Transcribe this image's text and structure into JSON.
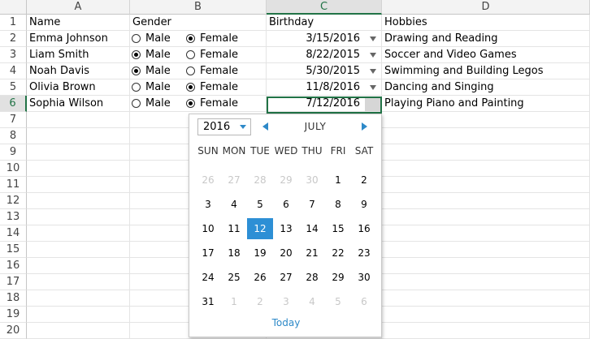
{
  "columns": [
    "A",
    "B",
    "C",
    "D"
  ],
  "rows": [
    "1",
    "2",
    "3",
    "4",
    "5",
    "6",
    "7",
    "8",
    "9",
    "10",
    "11",
    "12",
    "13",
    "14",
    "15",
    "16",
    "17",
    "18",
    "19",
    "20"
  ],
  "headers": {
    "name": "Name",
    "gender": "Gender",
    "birthday": "Birthday",
    "hobbies": "Hobbies"
  },
  "gender_options": {
    "male": "Male",
    "female": "Female"
  },
  "records": [
    {
      "name": "Emma Johnson",
      "gender": "Female",
      "birthday": "3/15/2016",
      "hobbies": "Drawing and Reading"
    },
    {
      "name": "Liam Smith",
      "gender": "Male",
      "birthday": "8/22/2015",
      "hobbies": "Soccer and Video Games"
    },
    {
      "name": "Noah Davis",
      "gender": "Male",
      "birthday": "5/30/2015",
      "hobbies": "Swimming and Building Legos"
    },
    {
      "name": "Olivia Brown",
      "gender": "Female",
      "birthday": "11/8/2016",
      "hobbies": "Dancing and Singing"
    },
    {
      "name": "Sophia Wilson",
      "gender": "Female",
      "birthday": "7/12/2016",
      "hobbies": "Playing Piano and Painting"
    }
  ],
  "calendar": {
    "year": "2016",
    "month": "JULY",
    "weekdays": [
      "SUN",
      "MON",
      "TUE",
      "WED",
      "THU",
      "FRI",
      "SAT"
    ],
    "weeks": [
      [
        {
          "d": "26",
          "o": true
        },
        {
          "d": "27",
          "o": true
        },
        {
          "d": "28",
          "o": true
        },
        {
          "d": "29",
          "o": true
        },
        {
          "d": "30",
          "o": true
        },
        {
          "d": "1"
        },
        {
          "d": "2"
        }
      ],
      [
        {
          "d": "3"
        },
        {
          "d": "4"
        },
        {
          "d": "5"
        },
        {
          "d": "6"
        },
        {
          "d": "7"
        },
        {
          "d": "8"
        },
        {
          "d": "9"
        }
      ],
      [
        {
          "d": "10"
        },
        {
          "d": "11"
        },
        {
          "d": "12",
          "s": true
        },
        {
          "d": "13"
        },
        {
          "d": "14"
        },
        {
          "d": "15"
        },
        {
          "d": "16"
        }
      ],
      [
        {
          "d": "17"
        },
        {
          "d": "18"
        },
        {
          "d": "19"
        },
        {
          "d": "20"
        },
        {
          "d": "21"
        },
        {
          "d": "22"
        },
        {
          "d": "23"
        }
      ],
      [
        {
          "d": "24"
        },
        {
          "d": "25"
        },
        {
          "d": "26"
        },
        {
          "d": "27"
        },
        {
          "d": "28"
        },
        {
          "d": "29"
        },
        {
          "d": "30"
        }
      ],
      [
        {
          "d": "31"
        },
        {
          "d": "1",
          "o": true
        },
        {
          "d": "2",
          "o": true
        },
        {
          "d": "3",
          "o": true
        },
        {
          "d": "4",
          "o": true
        },
        {
          "d": "5",
          "o": true
        },
        {
          "d": "6",
          "o": true
        }
      ]
    ],
    "today_label": "Today"
  },
  "colors": {
    "accent": "#217346",
    "selected_day": "#2d8fd5",
    "link": "#2d89c8"
  }
}
